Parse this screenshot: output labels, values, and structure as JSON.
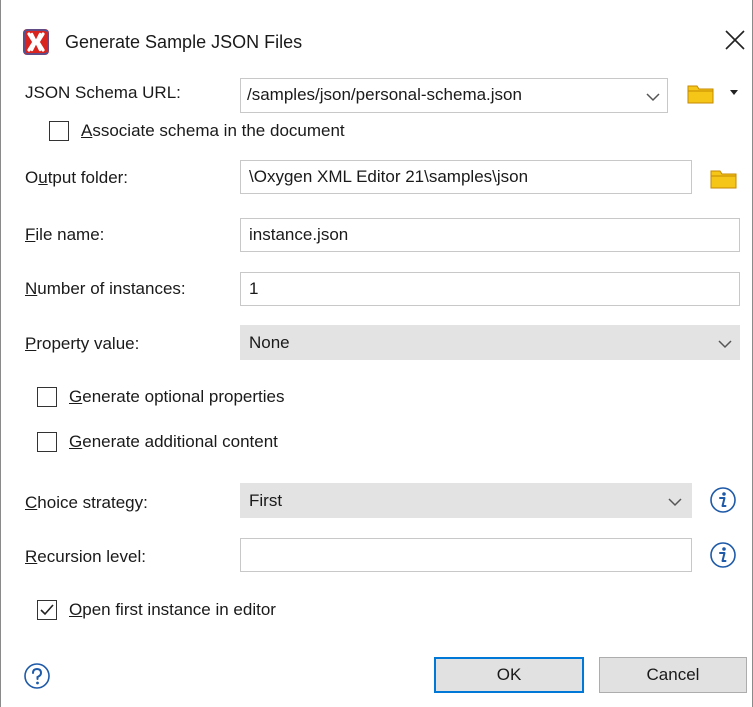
{
  "window": {
    "title": "Generate Sample JSON Files"
  },
  "form": {
    "schema_url": {
      "label_pre": "JSON Schema URL:",
      "value": "/samples/json/personal-schema.json"
    },
    "associate_schema": {
      "pre": "",
      "u": "A",
      "post": "ssociate schema in the document",
      "checked": false
    },
    "output_folder": {
      "pre": "O",
      "u": "u",
      "post": "tput folder:",
      "value": "\\Oxygen XML Editor 21\\samples\\json"
    },
    "file_name": {
      "pre": "",
      "u": "F",
      "post": "ile name:",
      "value": "instance.json"
    },
    "instances": {
      "pre": "",
      "u": "N",
      "post": "umber of instances:",
      "value": "1"
    },
    "property_value": {
      "pre": "",
      "u": "P",
      "post": "roperty value:",
      "value": "None"
    },
    "optional_props": {
      "pre": "",
      "u": "G",
      "post": "enerate optional properties",
      "checked": false
    },
    "additional_content": {
      "pre": "",
      "u": "G",
      "post": "enerate additional content",
      "checked": false
    },
    "choice_strategy": {
      "pre": "",
      "u": "C",
      "post": "hoice strategy:",
      "value": "First"
    },
    "recursion_level": {
      "pre": "",
      "u": "R",
      "post": "ecursion level:",
      "value": ""
    },
    "open_first": {
      "pre": "",
      "u": "O",
      "post": "pen first instance in editor",
      "checked": true
    }
  },
  "buttons": {
    "ok": "OK",
    "cancel": "Cancel"
  },
  "icons": {
    "app": "oxygen-logo-icon",
    "close": "close-icon",
    "folder": "folder-icon",
    "dropdown": "chevron-down-icon",
    "info": "info-icon",
    "help": "help-icon"
  },
  "colors": {
    "accent": "#0078d7",
    "folder": "#f5c518",
    "info": "#1e5aa8",
    "logo": "#d9231f"
  }
}
